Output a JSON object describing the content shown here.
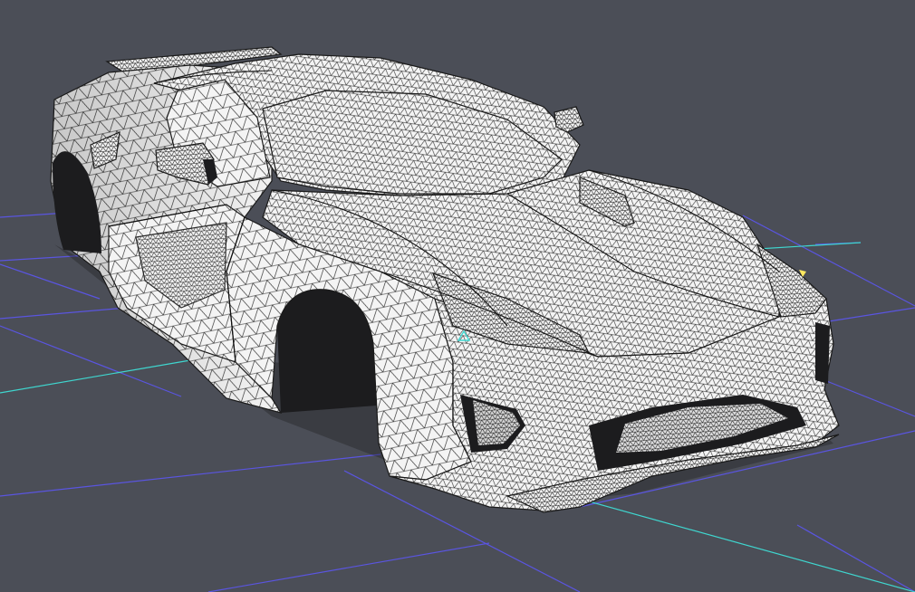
{
  "viewport": {
    "background": "#4b4e57",
    "grid_color": "#5a55e0",
    "axis_color": "#3fd6cf",
    "mesh_fill": "#f4f4f4",
    "mesh_stroke": "#1a1a1a",
    "shadow_color": "#1c1c1e",
    "marker_color": "#ffe860"
  },
  "model": {
    "render_mode": "wireframe-on-shaded",
    "subject": "sports-car-body-shell"
  }
}
